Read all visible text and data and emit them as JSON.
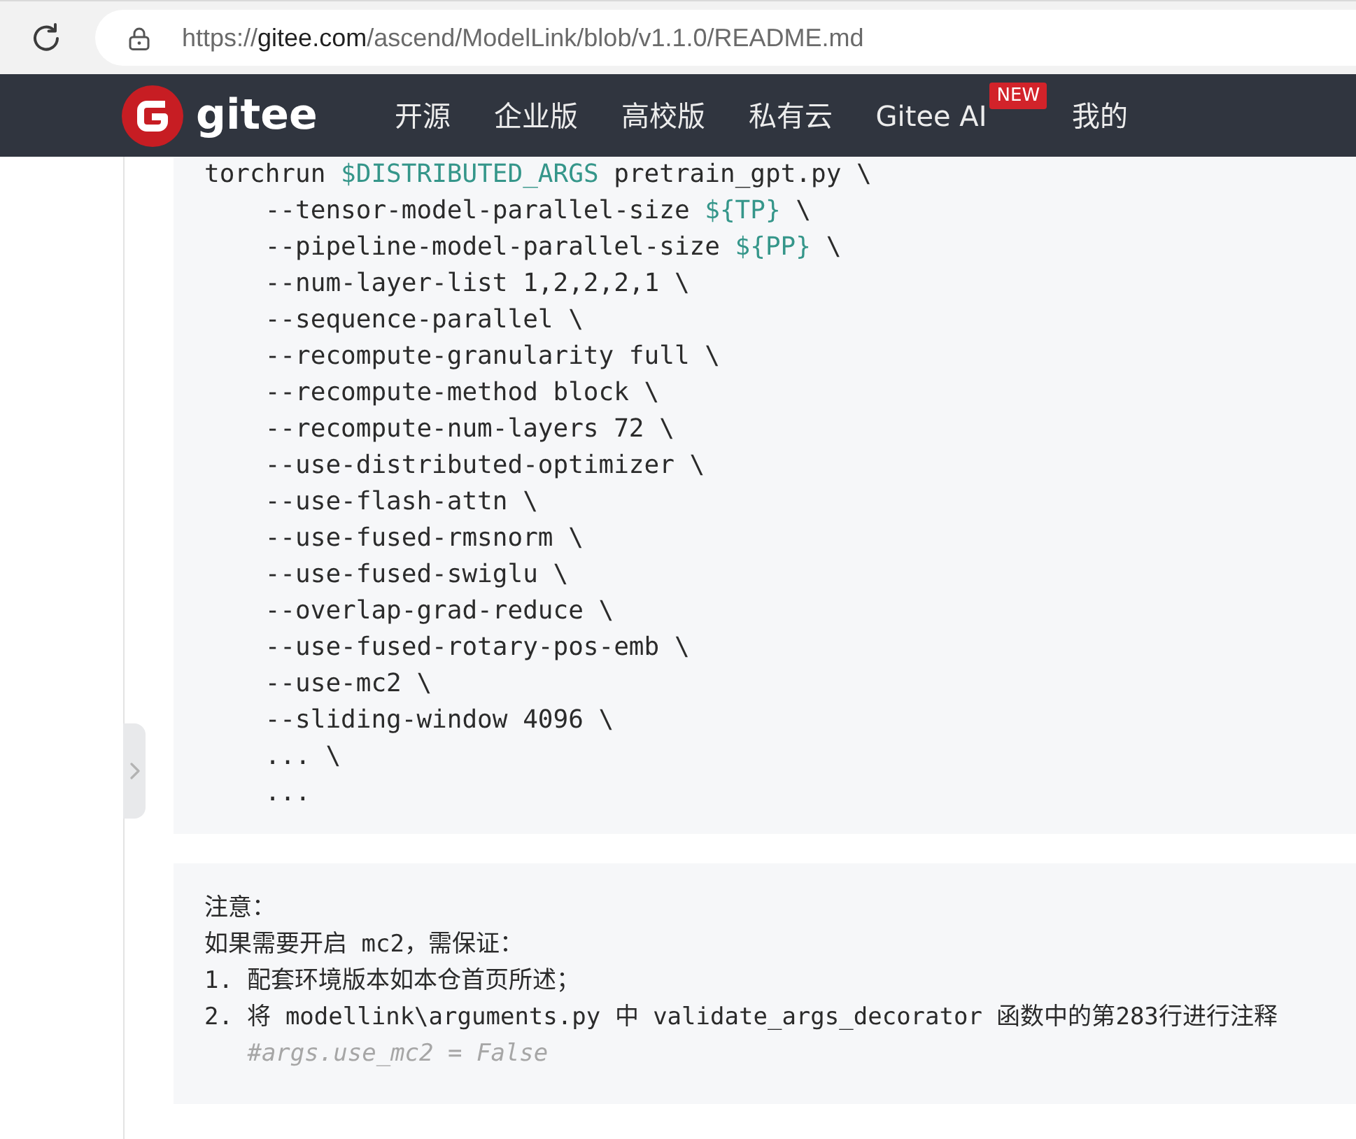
{
  "browser": {
    "url": "https://gitee.com/ascend/ModelLink/blob/v1.1.0/README.md"
  },
  "site_nav": {
    "logo_text": "gitee",
    "items": [
      {
        "label": "开源"
      },
      {
        "label": "企业版"
      },
      {
        "label": "高校版"
      },
      {
        "label": "私有云"
      },
      {
        "label": "Gitee AI",
        "badge": "NEW"
      },
      {
        "label": "我的"
      }
    ]
  },
  "code_block": {
    "lines": [
      {
        "kind": "command",
        "tokens": [
          {
            "kind": "plain",
            "text": "torchrun"
          },
          {
            "kind": "variable",
            "text": "$DISTRIBUTED_ARGS"
          },
          {
            "kind": "plain",
            "text": "pretrain_gpt.py \\"
          }
        ]
      },
      {
        "kind": "argument",
        "tokens": [
          {
            "kind": "plain",
            "text": "--tensor-model-parallel-size"
          },
          {
            "kind": "variable",
            "text": "${TP}"
          },
          {
            "kind": "plain",
            "text": "\\"
          }
        ]
      },
      {
        "kind": "argument",
        "tokens": [
          {
            "kind": "plain",
            "text": "--pipeline-model-parallel-size"
          },
          {
            "kind": "variable",
            "text": "${PP}"
          },
          {
            "kind": "plain",
            "text": "\\"
          }
        ]
      },
      {
        "kind": "argument",
        "tokens": [
          {
            "kind": "plain",
            "text": "--num-layer-list 1,2,2,2,1 \\"
          }
        ]
      },
      {
        "kind": "argument",
        "tokens": [
          {
            "kind": "plain",
            "text": "--sequence-parallel \\"
          }
        ]
      },
      {
        "kind": "argument",
        "tokens": [
          {
            "kind": "plain",
            "text": "--recompute-granularity full \\"
          }
        ]
      },
      {
        "kind": "argument",
        "tokens": [
          {
            "kind": "plain",
            "text": "--recompute-method block \\"
          }
        ]
      },
      {
        "kind": "argument",
        "tokens": [
          {
            "kind": "plain",
            "text": "--recompute-num-layers 72 \\"
          }
        ]
      },
      {
        "kind": "argument",
        "tokens": [
          {
            "kind": "plain",
            "text": "--use-distributed-optimizer \\"
          }
        ]
      },
      {
        "kind": "argument",
        "tokens": [
          {
            "kind": "plain",
            "text": "--use-flash-attn \\"
          }
        ]
      },
      {
        "kind": "argument",
        "tokens": [
          {
            "kind": "plain",
            "text": "--use-fused-rmsnorm \\"
          }
        ]
      },
      {
        "kind": "argument",
        "tokens": [
          {
            "kind": "plain",
            "text": "--use-fused-swiglu \\"
          }
        ]
      },
      {
        "kind": "argument",
        "tokens": [
          {
            "kind": "plain",
            "text": "--overlap-grad-reduce \\"
          }
        ]
      },
      {
        "kind": "argument",
        "tokens": [
          {
            "kind": "plain",
            "text": "--use-fused-rotary-pos-emb \\"
          }
        ]
      },
      {
        "kind": "argument",
        "tokens": [
          {
            "kind": "plain",
            "text": "--use-mc2 \\"
          }
        ]
      },
      {
        "kind": "argument",
        "tokens": [
          {
            "kind": "plain",
            "text": "--sliding-window 4096 \\"
          }
        ]
      },
      {
        "kind": "argument",
        "tokens": [
          {
            "kind": "plain",
            "text": "... \\"
          }
        ]
      },
      {
        "kind": "argument",
        "tokens": [
          {
            "kind": "plain",
            "text": "..."
          }
        ]
      }
    ]
  },
  "note_block": {
    "lines": [
      {
        "kind": "text",
        "text": "注意："
      },
      {
        "kind": "text",
        "text": "如果需要开启 mc2，需保证："
      },
      {
        "kind": "text",
        "text": "1. 配套环境版本如本仓首页所述；"
      },
      {
        "kind": "text",
        "text": "2. 将 modellink\\arguments.py 中 validate_args_decorator 函数中的第283行进行注释"
      },
      {
        "kind": "comment",
        "text": "#args.use_mc2 = False"
      }
    ]
  }
}
